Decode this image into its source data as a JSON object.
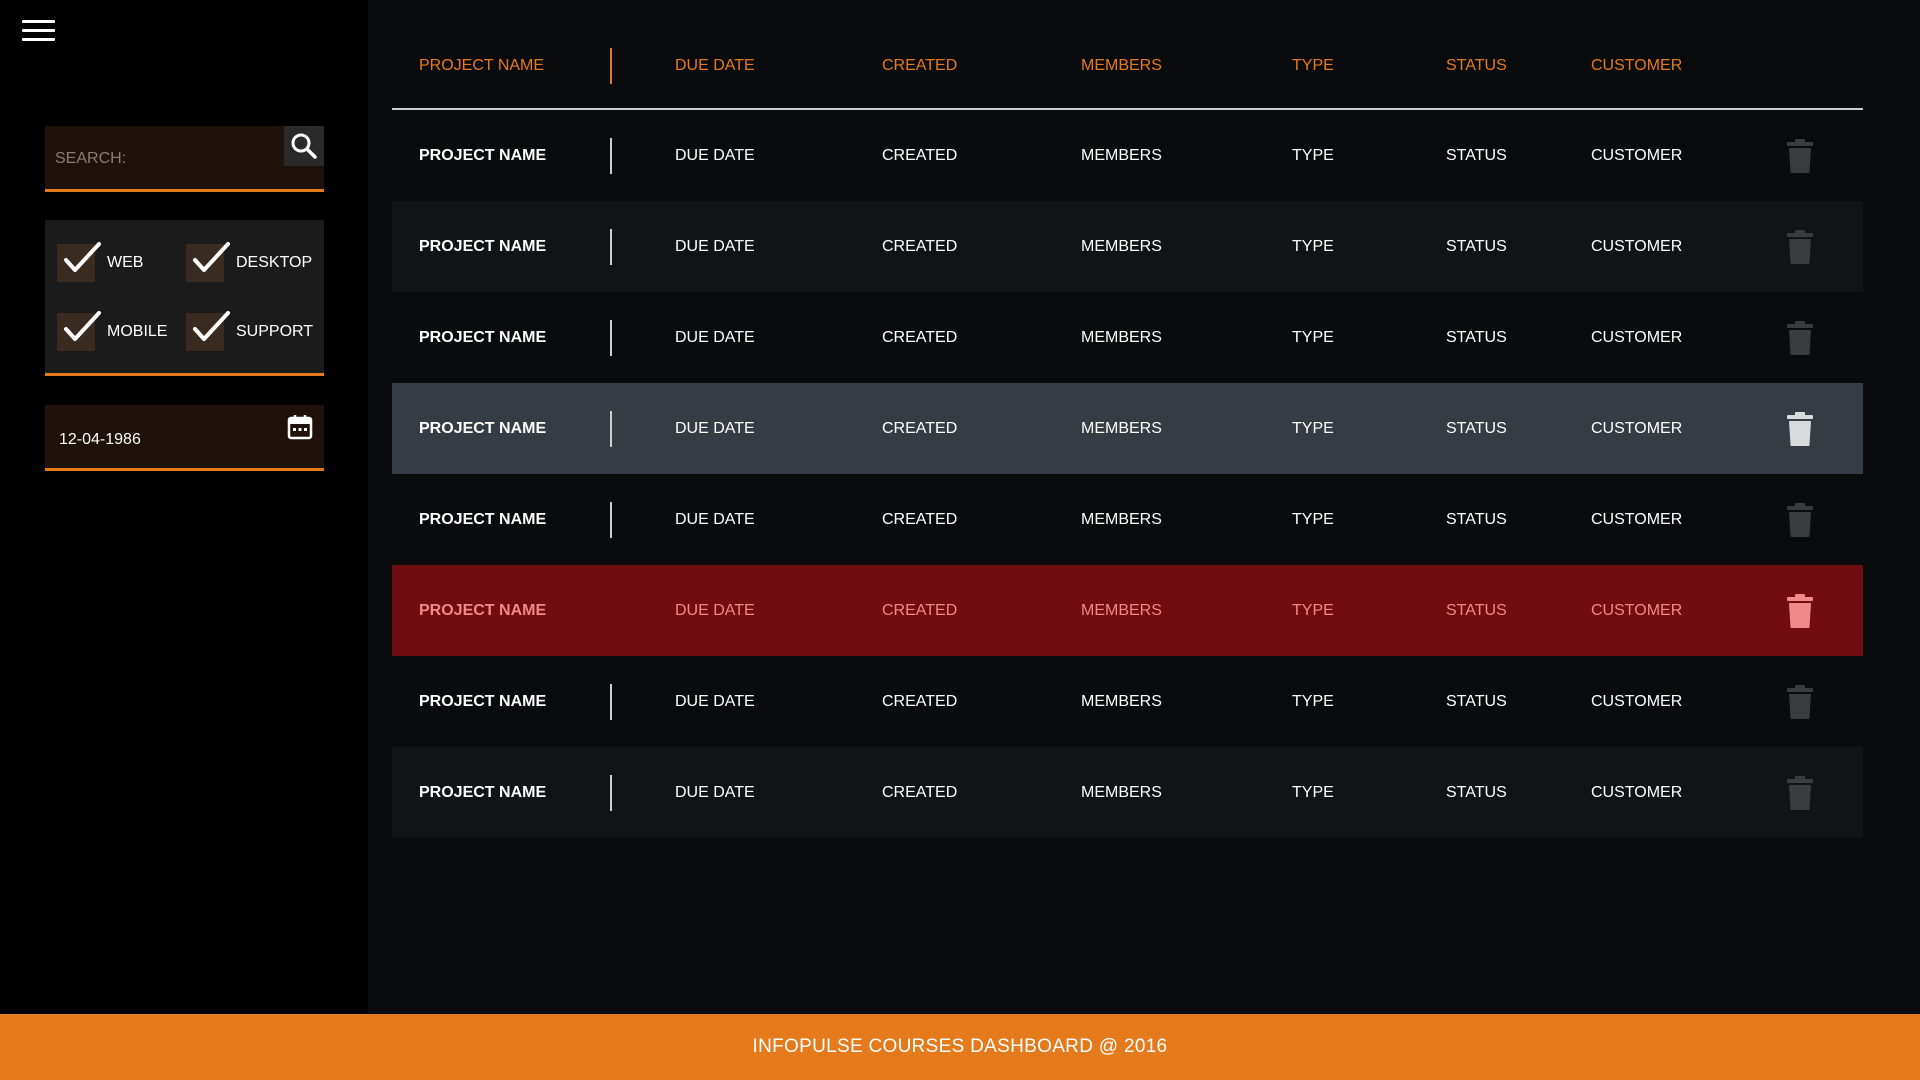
{
  "sidebar": {
    "menu_icon": "hamburger-menu-icon",
    "search": {
      "placeholder": "SEARCH:",
      "value": "",
      "icon": "search-icon"
    },
    "filters": [
      {
        "label": "WEB",
        "checked": true
      },
      {
        "label": "DESKTOP",
        "checked": true
      },
      {
        "label": "MOBILE",
        "checked": true
      },
      {
        "label": "SUPPORT",
        "checked": true
      }
    ],
    "date": {
      "value": "12-04-1986",
      "icon": "calendar-icon"
    }
  },
  "table": {
    "headers": {
      "name": "PROJECT NAME",
      "due": "DUE DATE",
      "created": "CREATED",
      "members": "MEMBERS",
      "type": "TYPE",
      "status": "STATUS",
      "customer": "CUSTOMER"
    },
    "rows": [
      {
        "name": "PROJECT NAME",
        "due": "DUE DATE",
        "created": "CREATED",
        "members": "MEMBERS",
        "type": "TYPE",
        "status": "STATUS",
        "customer": "CUSTOMER",
        "state": "normal"
      },
      {
        "name": "PROJECT NAME",
        "due": "DUE DATE",
        "created": "CREATED",
        "members": "MEMBERS",
        "type": "TYPE",
        "status": "STATUS",
        "customer": "CUSTOMER",
        "state": "alt"
      },
      {
        "name": "PROJECT NAME",
        "due": "DUE DATE",
        "created": "CREATED",
        "members": "MEMBERS",
        "type": "TYPE",
        "status": "STATUS",
        "customer": "CUSTOMER",
        "state": "normal"
      },
      {
        "name": "PROJECT NAME",
        "due": "DUE DATE",
        "created": "CREATED",
        "members": "MEMBERS",
        "type": "TYPE",
        "status": "STATUS",
        "customer": "CUSTOMER",
        "state": "selected"
      },
      {
        "name": "PROJECT NAME",
        "due": "DUE DATE",
        "created": "CREATED",
        "members": "MEMBERS",
        "type": "TYPE",
        "status": "STATUS",
        "customer": "CUSTOMER",
        "state": "normal"
      },
      {
        "name": "PROJECT NAME",
        "due": "DUE DATE",
        "created": "CREATED",
        "members": "MEMBERS",
        "type": "TYPE",
        "status": "STATUS",
        "customer": "CUSTOMER",
        "state": "danger"
      },
      {
        "name": "PROJECT NAME",
        "due": "DUE DATE",
        "created": "CREATED",
        "members": "MEMBERS",
        "type": "TYPE",
        "status": "STATUS",
        "customer": "CUSTOMER",
        "state": "normal"
      },
      {
        "name": "PROJECT NAME",
        "due": "DUE DATE",
        "created": "CREATED",
        "members": "MEMBERS",
        "type": "TYPE",
        "status": "STATUS",
        "customer": "CUSTOMER",
        "state": "alt"
      }
    ],
    "delete_icon": "trash-icon"
  },
  "footer": {
    "text": "INFOPULSE COURSES DASHBOARD @ 2016"
  },
  "colors": {
    "accent": "#e57a1c",
    "background": "#0a0b0d",
    "sidebar": "#000000",
    "selected_row": "#363c44",
    "danger_row": "#6f0d10",
    "danger_text": "#f0898a"
  }
}
